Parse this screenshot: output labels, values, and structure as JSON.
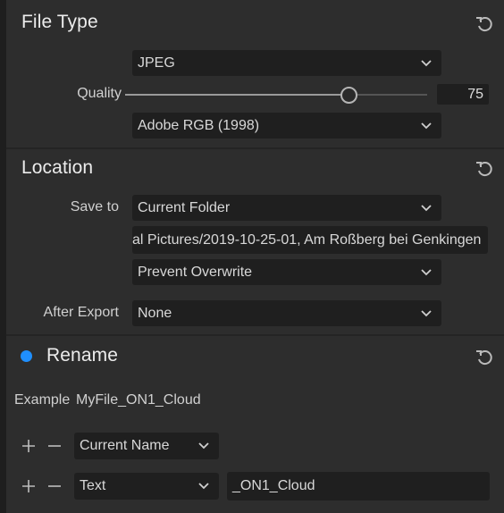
{
  "file_type": {
    "title": "File Type",
    "format": "JPEG",
    "quality_label": "Quality",
    "quality_value": "75",
    "quality_fraction": 0.75,
    "color_space": "Adobe RGB (1998)"
  },
  "location": {
    "title": "Location",
    "save_to_label": "Save to",
    "save_to_value": "Current Folder",
    "path_value": "al Pictures/2019-10-25-01, Am Roßberg bei Genkingen",
    "overwrite_value": "Prevent Overwrite",
    "after_export_label": "After Export",
    "after_export_value": "None"
  },
  "rename": {
    "title": "Rename",
    "enabled_color": "#1f8fff",
    "example_label": "Example",
    "example_value": "MyFile_ON1_Cloud",
    "rows": [
      {
        "token": "Current Name",
        "text": ""
      },
      {
        "token": "Text",
        "text": "_ON1_Cloud"
      }
    ]
  },
  "icons": [
    "reset-icon",
    "chevron-down-icon",
    "plus-icon",
    "minus-icon"
  ]
}
